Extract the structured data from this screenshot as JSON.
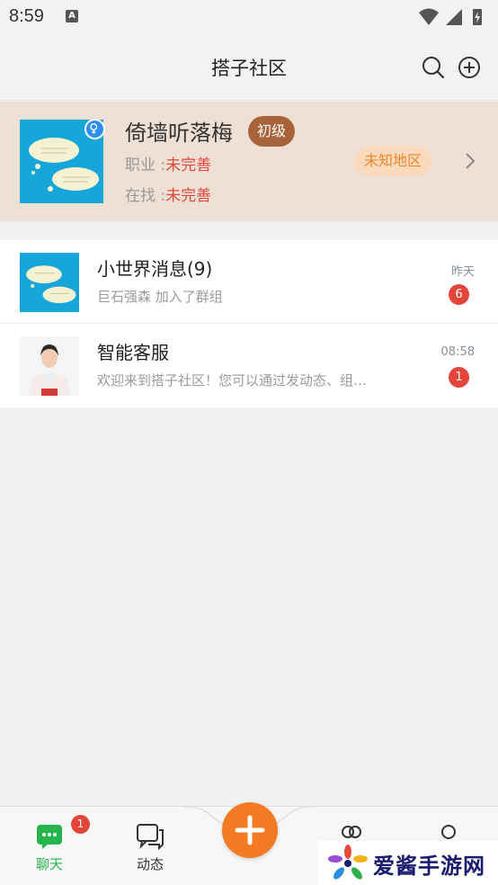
{
  "status_bar": {
    "time": "8:59",
    "notif_icon": "a-icon"
  },
  "header": {
    "title": "搭子社区",
    "search_icon": "search-icon",
    "add_icon": "plus-circle-icon"
  },
  "profile": {
    "name": "倚墙听落梅",
    "level": "初级",
    "job_label": "职业 :",
    "job_value": "未完善",
    "seeking_label": "在找 :",
    "seeking_value": "未完善",
    "region": "未知地区",
    "gender_icon": "female-icon"
  },
  "chats": [
    {
      "name": "小世界消息(9)",
      "preview": "巨石强森 加入了群组",
      "time": "昨天",
      "unread": "6",
      "avatar": "cloud-avatar"
    },
    {
      "name": "智能客服",
      "preview": "欢迎来到搭子社区！您可以通过发动态、组…",
      "time": "08:58",
      "unread": "1",
      "avatar": "service-agent-avatar"
    }
  ],
  "tabs": [
    {
      "label": "聊天",
      "badge": "1",
      "icon": "chat-icon",
      "active": true
    },
    {
      "label": "动态",
      "icon": "feed-icon",
      "active": false
    },
    {
      "label": "",
      "icon": "contacts-icon",
      "active": false
    },
    {
      "label": "",
      "icon": "profile-icon",
      "active": false
    }
  ],
  "watermark": {
    "text": "爱酱手游网"
  },
  "colors": {
    "accent": "#27b34e",
    "fab": "#f47b24",
    "badge": "#e3453a",
    "level": "#a8633a",
    "profile_bg": "#efe0d6"
  }
}
